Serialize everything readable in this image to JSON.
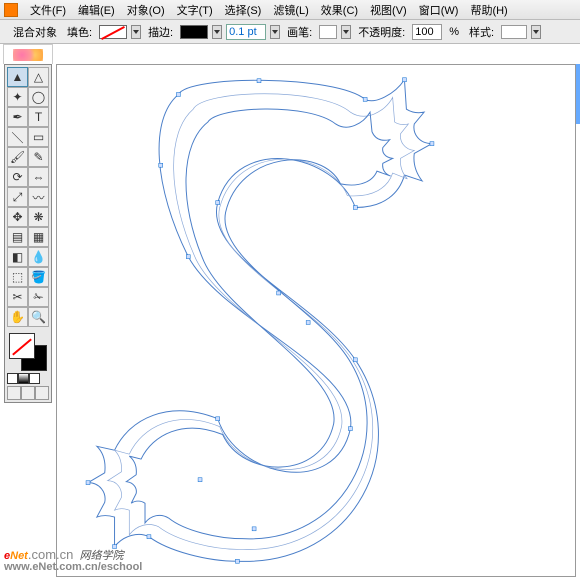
{
  "menu": {
    "file": "文件(F)",
    "edit": "编辑(E)",
    "object": "对象(O)",
    "text": "文字(T)",
    "select": "选择(S)",
    "filter": "滤镜(L)",
    "effect": "效果(C)",
    "view": "视图(V)",
    "window": "窗口(W)",
    "help": "帮助(H)"
  },
  "options": {
    "blend_label": "混合对象",
    "fill_label": "填色:",
    "stroke_label": "描边:",
    "stroke_weight": "0.1 pt",
    "brush_label": "画笔:",
    "opacity_label": "不透明度:",
    "opacity_value": "100",
    "opacity_suffix": "%",
    "style_label": "样式:"
  },
  "toolbox": {
    "rows": [
      [
        "selection",
        "direct-selection"
      ],
      [
        "magic-wand",
        "lasso"
      ],
      [
        "pen",
        "type"
      ],
      [
        "line",
        "rectangle"
      ],
      [
        "paintbrush",
        "pencil"
      ],
      [
        "rotate",
        "reflect"
      ],
      [
        "scale",
        "warp"
      ],
      [
        "free-transform",
        "symbol-sprayer"
      ],
      [
        "graph",
        "mesh"
      ],
      [
        "gradient",
        "eyedropper"
      ],
      [
        "blend",
        "live-paint"
      ],
      [
        "slice",
        "scissors"
      ],
      [
        "hand",
        "zoom"
      ]
    ]
  },
  "watermark": {
    "brand_e": "e",
    "brand_net": "Net",
    "brand_com": ".com.cn",
    "brand_cn": "网络学院",
    "url": "www.eNet.com.cn/eschool"
  }
}
